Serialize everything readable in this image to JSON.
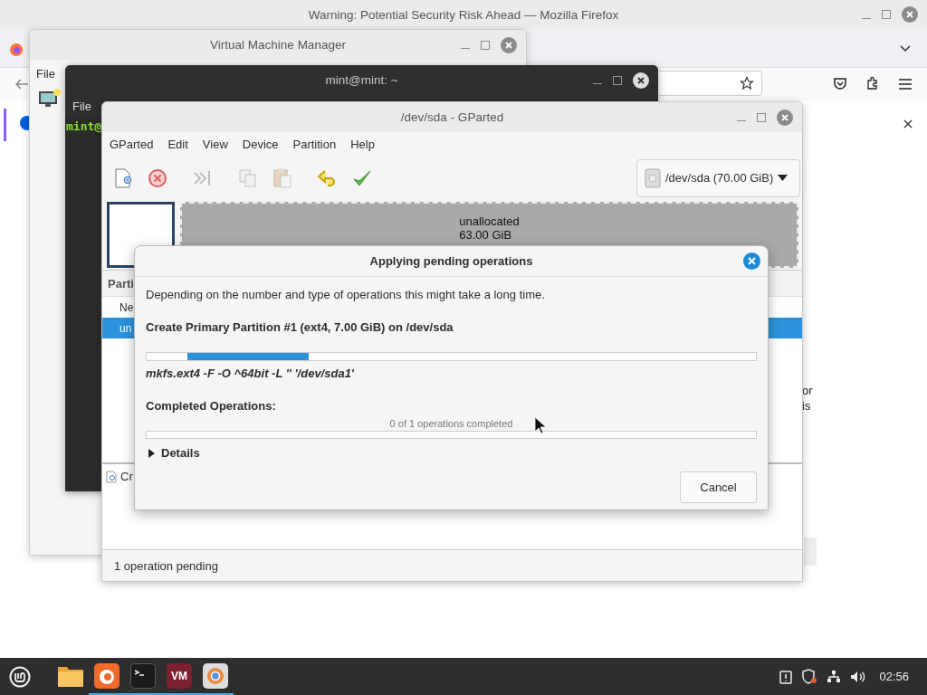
{
  "firefox": {
    "title": "Warning: Potential Security Risk Ahead — Mozilla Firefox",
    "page_fragments": [
      "or",
      "is"
    ]
  },
  "vmm": {
    "title": "Virtual Machine Manager",
    "menu": [
      "File"
    ]
  },
  "terminal": {
    "title": "mint@mint: ~",
    "menu": [
      "File"
    ],
    "prompt": "mint@"
  },
  "gparted": {
    "title": "/dev/sda - GParted",
    "menu": [
      "GParted",
      "Edit",
      "View",
      "Device",
      "Partition",
      "Help"
    ],
    "toolbar": [
      {
        "kind": "new",
        "disabled": false
      },
      {
        "kind": "delete",
        "disabled": false
      },
      {
        "kind": "resize",
        "disabled": true
      },
      {
        "kind": "copy",
        "disabled": true
      },
      {
        "kind": "paste",
        "disabled": true
      },
      {
        "kind": "undo",
        "disabled": false
      },
      {
        "kind": "apply",
        "disabled": false
      }
    ],
    "device": "/dev/sda (70.00 GiB)",
    "graph": {
      "label": "unallocated",
      "size": "63.00 GiB"
    },
    "list": {
      "header": "Parti",
      "rows": [
        {
          "text": "Ne",
          "selected": false
        },
        {
          "text": "un",
          "selected": true
        }
      ]
    },
    "pending": [
      "Cr"
    ],
    "status": "1 operation pending"
  },
  "dialog": {
    "title": "Applying pending operations",
    "intro": "Depending on the number and type of operations this might take a long time.",
    "operation": "Create Primary Partition #1 (ext4, 7.00 GiB) on /dev/sda",
    "command": "mkfs.ext4 -F -O ^64bit -L '' '/dev/sda1'",
    "completed_label": "Completed Operations:",
    "completed_text": "0 of 1 operations completed",
    "completed": {
      "level": 0
    },
    "details": {
      "label": "Details",
      "expanded": false
    },
    "cancel": "Cancel"
  },
  "taskbar": {
    "apps": [
      {
        "kind": "files",
        "running": false
      },
      {
        "kind": "firefox",
        "running": true
      },
      {
        "kind": "terminal",
        "running": true
      },
      {
        "kind": "vm",
        "label": "VM",
        "running": true
      },
      {
        "kind": "chromium",
        "running": true
      }
    ],
    "clock": "02:56"
  }
}
